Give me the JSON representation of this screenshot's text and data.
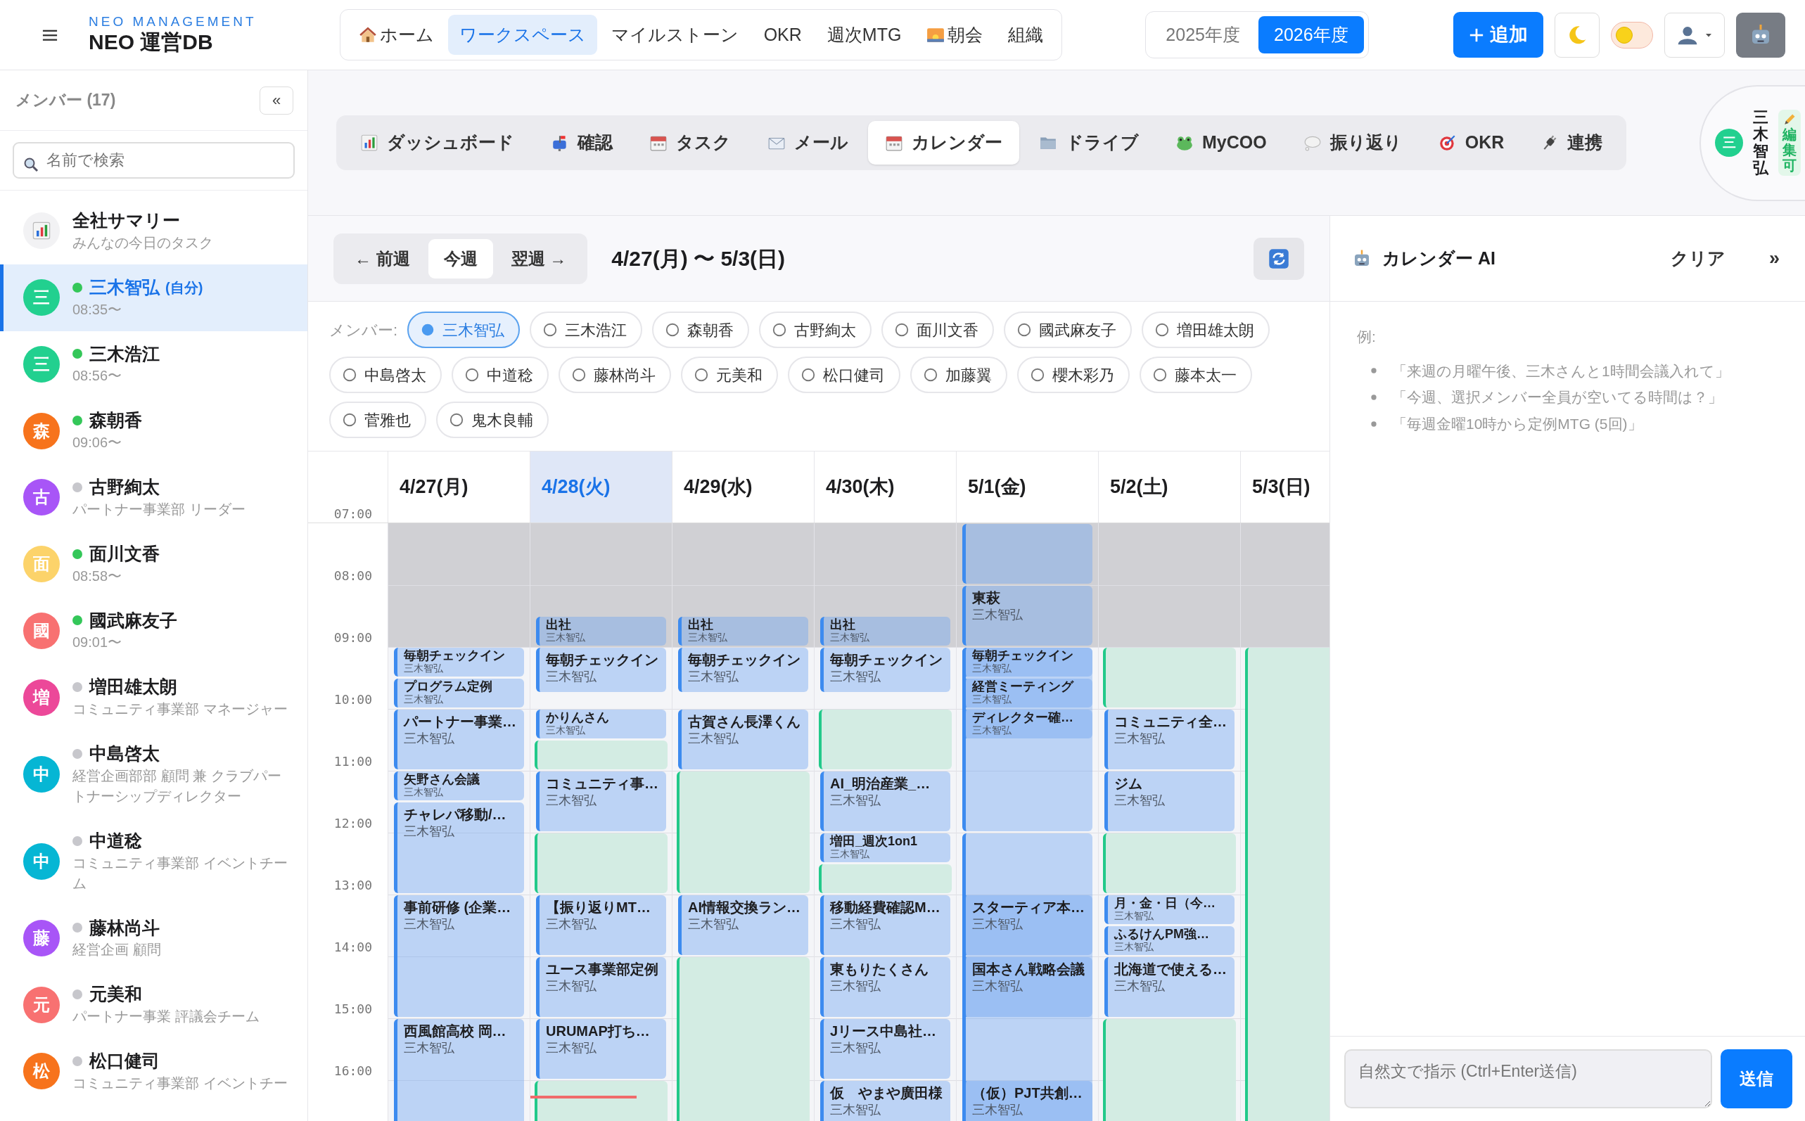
{
  "header": {
    "brand_tagline": "NEO MANAGEMENT",
    "brand_title": "NEO 運営DB",
    "nav": [
      {
        "label": "ホーム",
        "selected": false
      },
      {
        "label": "ワークスペース",
        "selected": true
      },
      {
        "label": "マイルストーン",
        "selected": false
      },
      {
        "label": "OKR",
        "selected": false
      },
      {
        "label": "週次MTG",
        "selected": false
      },
      {
        "label": "朝会",
        "selected": false
      },
      {
        "label": "組織",
        "selected": false
      }
    ],
    "years": [
      {
        "label": "2025年度",
        "selected": false
      },
      {
        "label": "2026年度",
        "selected": true
      }
    ],
    "add_button": "追加",
    "theme_toggle": {
      "on": false
    }
  },
  "sidebar": {
    "title": "メンバー (17)",
    "collapse": "«",
    "search_placeholder": "名前で検索",
    "items": [
      {
        "kind": "summary",
        "name": "全社サマリー",
        "sub": "みんなの今日のタスク",
        "selected": false
      },
      {
        "kind": "member",
        "initial": "三",
        "color": "#22d08f",
        "online": true,
        "name": "三木智弘",
        "tag": "(自分)",
        "sub": "08:35〜",
        "selected": true
      },
      {
        "kind": "member",
        "initial": "三",
        "color": "#22d08f",
        "online": true,
        "name": "三木浩江",
        "sub": "08:56〜",
        "selected": false
      },
      {
        "kind": "member",
        "initial": "森",
        "color": "#f7731c",
        "online": true,
        "name": "森朝香",
        "sub": "09:06〜",
        "selected": false
      },
      {
        "kind": "member",
        "initial": "古",
        "color": "#a855f7",
        "online": false,
        "name": "古野絢太",
        "sub": "パートナー事業部 リーダー",
        "selected": false
      },
      {
        "kind": "member",
        "initial": "面",
        "color": "#fcd36a",
        "online": true,
        "name": "面川文香",
        "sub": "08:58〜",
        "selected": false
      },
      {
        "kind": "member",
        "initial": "國",
        "color": "#f87171",
        "online": true,
        "name": "國武麻友子",
        "sub": "09:01〜",
        "selected": false
      },
      {
        "kind": "member",
        "initial": "増",
        "color": "#ec4899",
        "online": false,
        "name": "増田雄太朗",
        "sub": "コミュニティ事業部 マネージャー",
        "selected": false
      },
      {
        "kind": "member",
        "initial": "中",
        "color": "#06b6d4",
        "online": false,
        "name": "中島啓太",
        "sub": "経営企画部部 顧問 兼 クラブパートナーシップディレクター",
        "selected": false
      },
      {
        "kind": "member",
        "initial": "中",
        "color": "#06b6d4",
        "online": false,
        "name": "中道稔",
        "sub": "コミュニティ事業部 イベントチーム",
        "selected": false
      },
      {
        "kind": "member",
        "initial": "藤",
        "color": "#a855f7",
        "online": false,
        "name": "藤林尚斗",
        "sub": "経営企画 顧問",
        "selected": false
      },
      {
        "kind": "member",
        "initial": "元",
        "color": "#f87171",
        "online": false,
        "name": "元美和",
        "sub": "パートナー事業 評議会チーム",
        "selected": false
      },
      {
        "kind": "member",
        "initial": "松",
        "color": "#f7731c",
        "online": false,
        "name": "松口健司",
        "sub": "コミュニティ事業部 イベントチー",
        "selected": false
      }
    ]
  },
  "tabs": [
    {
      "label": "ダッシュボード",
      "selected": false
    },
    {
      "label": "確認",
      "selected": false
    },
    {
      "label": "タスク",
      "selected": false
    },
    {
      "label": "メール",
      "selected": false
    },
    {
      "label": "カレンダー",
      "selected": true
    },
    {
      "label": "ドライブ",
      "selected": false
    },
    {
      "label": "MyCOO",
      "selected": false
    },
    {
      "label": "振り返り",
      "selected": false
    },
    {
      "label": "OKR",
      "selected": false
    },
    {
      "label": "連携",
      "selected": false
    }
  ],
  "profile": {
    "initial": "三",
    "color": "#22d08f",
    "name": "三木智弘",
    "permission": "編集可"
  },
  "calendar": {
    "nav": [
      {
        "label": "← 前週",
        "selected": false
      },
      {
        "label": "今週",
        "selected": true
      },
      {
        "label": "翌週 →",
        "selected": false
      }
    ],
    "range": "4/27(月) 〜 5/3(日)",
    "members_label": "メンバー:",
    "members": [
      {
        "name": "三木智弘",
        "selected": true
      },
      {
        "name": "三木浩江",
        "selected": false
      },
      {
        "name": "森朝香",
        "selected": false
      },
      {
        "name": "古野絢太",
        "selected": false
      },
      {
        "name": "面川文香",
        "selected": false
      },
      {
        "name": "國武麻友子",
        "selected": false
      },
      {
        "name": "増田雄太朗",
        "selected": false
      },
      {
        "name": "中島啓太",
        "selected": false
      },
      {
        "name": "中道稔",
        "selected": false
      },
      {
        "name": "藤林尚斗",
        "selected": false
      },
      {
        "name": "元美和",
        "selected": false
      },
      {
        "name": "松口健司",
        "selected": false
      },
      {
        "name": "加藤翼",
        "selected": false
      },
      {
        "name": "櫻木彩乃",
        "selected": false
      },
      {
        "name": "藤本太一",
        "selected": false
      },
      {
        "name": "菅雅也",
        "selected": false
      },
      {
        "name": "鬼木良輔",
        "selected": false
      }
    ],
    "hours": [
      "07:00",
      "08:00",
      "09:00",
      "10:00",
      "11:00",
      "12:00",
      "13:00",
      "14:00",
      "15:00",
      "16:00"
    ],
    "days": [
      {
        "label": "4/27(月)",
        "today": false,
        "events": [
          {
            "kind": "event",
            "title": "毎朝チェックイン",
            "owner": "三木智弘"
          },
          {
            "kind": "event",
            "title": "プログラム定例",
            "owner": "三木智弘"
          },
          {
            "kind": "event",
            "title": "パートナー事業…",
            "owner": "三木智弘"
          },
          {
            "kind": "event",
            "title": "矢野さん会議",
            "owner": "三木智弘"
          },
          {
            "kind": "event",
            "title": "チャレパ移動/…",
            "owner": "三木智弘"
          },
          {
            "kind": "event",
            "title": "事前研修 (企業…",
            "owner": "三木智弘"
          },
          {
            "kind": "event",
            "title": "西風館高校 岡…",
            "owner": "三木智弘"
          }
        ]
      },
      {
        "label": "4/28(火)",
        "today": true,
        "events": [
          {
            "kind": "event",
            "title": "出社",
            "owner": "三木智弘"
          },
          {
            "kind": "event",
            "title": "毎朝チェックイン",
            "owner": "三木智弘"
          },
          {
            "kind": "event",
            "title": "かりんさん",
            "owner": "三木智弘"
          },
          {
            "kind": "free"
          },
          {
            "kind": "event",
            "title": "コミュニティ事…",
            "owner": "三木智弘"
          },
          {
            "kind": "free"
          },
          {
            "kind": "event",
            "title": "【振り返りMT…",
            "owner": "三木智弘"
          },
          {
            "kind": "event",
            "title": "ユース事業部定例",
            "owner": "三木智弘"
          },
          {
            "kind": "event",
            "title": "URUMAP打ち…",
            "owner": "三木智弘"
          },
          {
            "kind": "free"
          }
        ]
      },
      {
        "label": "4/29(水)",
        "today": false,
        "events": [
          {
            "kind": "event",
            "title": "出社",
            "owner": "三木智弘"
          },
          {
            "kind": "event",
            "title": "毎朝チェックイン",
            "owner": "三木智弘"
          },
          {
            "kind": "event",
            "title": "古賀さん長澤くん",
            "owner": "三木智弘"
          },
          {
            "kind": "free"
          },
          {
            "kind": "event",
            "title": "AI情報交換ラン…",
            "owner": "三木智弘"
          },
          {
            "kind": "free"
          }
        ]
      },
      {
        "label": "4/30(木)",
        "today": false,
        "events": [
          {
            "kind": "event",
            "title": "出社",
            "owner": "三木智弘"
          },
          {
            "kind": "event",
            "title": "毎朝チェックイン",
            "owner": "三木智弘"
          },
          {
            "kind": "free"
          },
          {
            "kind": "event",
            "title": "AI_明治産業_…",
            "owner": "三木智弘"
          },
          {
            "kind": "event",
            "title": "増田_週次1on1",
            "owner": "三木智弘"
          },
          {
            "kind": "free"
          },
          {
            "kind": "event",
            "title": "移動経費確認M…",
            "owner": "三木智弘"
          },
          {
            "kind": "event",
            "title": "東もりたくさん",
            "owner": "三木智弘"
          },
          {
            "kind": "event",
            "title": "Jリース中島社…",
            "owner": "三木智弘"
          },
          {
            "kind": "event",
            "title": "仮　やまや廣田様",
            "owner": "三木智弘"
          }
        ]
      },
      {
        "label": "5/1(金)",
        "today": false,
        "events": [
          {
            "kind": "event"
          },
          {
            "kind": "event",
            "title": "東萩",
            "owner": "三木智弘"
          },
          {
            "kind": "event"
          },
          {
            "kind": "event"
          },
          {
            "kind": "event",
            "title": "毎朝チェックイン",
            "owner": "三木智弘"
          },
          {
            "kind": "event",
            "title": "経営ミーティング",
            "owner": "三木智弘"
          },
          {
            "kind": "event",
            "title": "ディレクター確…",
            "owner": "三木智弘"
          },
          {
            "kind": "event",
            "title": "スターティア本…",
            "owner": "三木智弘"
          },
          {
            "kind": "event",
            "title": "国本さん戦略会議",
            "owner": "三木智弘"
          },
          {
            "kind": "event",
            "title": "（仮）PJT共創…",
            "owner": "三木智弘"
          }
        ]
      },
      {
        "label": "5/2(土)",
        "today": false,
        "events": [
          {
            "kind": "free"
          },
          {
            "kind": "event",
            "title": "コミュニティ全…",
            "owner": "三木智弘"
          },
          {
            "kind": "event",
            "title": "ジム",
            "owner": "三木智弘"
          },
          {
            "kind": "free"
          },
          {
            "kind": "event",
            "title": "月・金・日（今…",
            "owner": "三木智弘"
          },
          {
            "kind": "event",
            "title": "ふるけんPM強…",
            "owner": "三木智弘"
          },
          {
            "kind": "event",
            "title": "北海道で使える…",
            "owner": "三木智弘"
          },
          {
            "kind": "free"
          }
        ]
      },
      {
        "label": "5/3(日)",
        "today": false,
        "events": [
          {
            "kind": "free"
          }
        ]
      }
    ]
  },
  "ai": {
    "title": "カレンダー AI",
    "clear": "クリア",
    "collapse": "»",
    "examples_label": "例:",
    "examples": [
      "「来週の月曜午後、三木さんと1時間会議入れて」",
      "「今週、選択メンバー全員が空いてる時間は？」",
      "「毎週金曜10時から定例MTG (5回)」"
    ],
    "input_placeholder": "自然文で指示 (Ctrl+Enter送信)",
    "send": "送信"
  }
}
